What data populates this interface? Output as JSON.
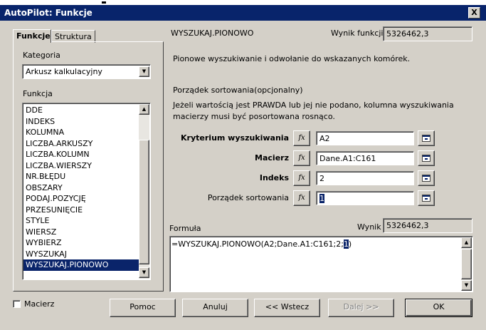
{
  "window": {
    "title": "AutoPilot: Funkcje",
    "close_label": "X"
  },
  "tabs": [
    {
      "label": "Funkcje"
    },
    {
      "label": "Struktura"
    }
  ],
  "left_panel": {
    "category_label": "Kategoria",
    "category_value": "Arkusz kalkulacyjny",
    "function_label": "Funkcja",
    "functions": [
      "DDE",
      "INDEKS",
      "KOLUMNA",
      "LICZBA.ARKUSZY",
      "LICZBA.KOLUMN",
      "LICZBA.WIERSZY",
      "NR.BŁĘDU",
      "OBSZARY",
      "PODAJ.POZYCJĘ",
      "PRZESUNIĘCIE",
      "STYLE",
      "WIERSZ",
      "WYBIERZ",
      "WYSZUKAJ",
      "WYSZUKAJ.PIONOWO"
    ],
    "selected_function": "WYSZUKAJ.PIONOWO"
  },
  "right_panel": {
    "function_name": "WYSZUKAJ.PIONOWO",
    "result_label": "Wynik funkcji",
    "result_value": "5326462,3",
    "description": "Pionowe wyszukiwanie i odwołanie do wskazanych komórek.",
    "param_title": "Porządek sortowania(opcjonalny)",
    "param_desc_line1": "Jeżeli wartością jest PRAWDA lub jej nie podano, kolumna wyszukiwania",
    "param_desc_line2": "macierzy musi być posortowana rosnąco.",
    "args": [
      {
        "label": "Kryterium wyszukiwania",
        "value": "A2"
      },
      {
        "label": "Macierz",
        "value": "Dane.A1:C161"
      },
      {
        "label": "Indeks",
        "value": "2"
      },
      {
        "label": "Porządek sortowania",
        "value": "1"
      }
    ],
    "fx_label": "fx",
    "formula_label": "Formuła",
    "formula_result_label": "Wynik",
    "formula_result_value": "5326462,3",
    "formula_prefix": "=WYSZUKAJ.PIONOWO(A2;Dane.A1:C161;2;",
    "formula_cursor": "1",
    "formula_suffix": ")"
  },
  "bottom": {
    "matrix_checkbox_label": "Macierz",
    "help_label": "Pomoc",
    "cancel_label": "Anuluj",
    "back_label": "<< Wstecz",
    "next_label": "Dalej >>",
    "ok_label": "OK"
  },
  "colors": {
    "titlebar": "#08246b",
    "selection": "#0a246a",
    "dialog_bg": "#d4d0c8"
  }
}
